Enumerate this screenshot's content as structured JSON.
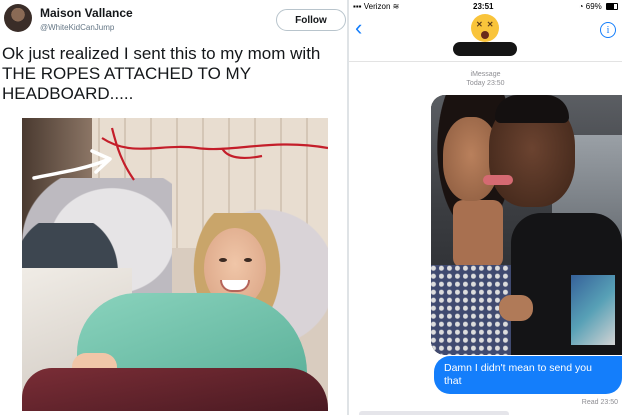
{
  "tweet": {
    "author_name": "Maison Vallance",
    "author_handle": "@WhiteKidCanJump",
    "follow_label": "Follow",
    "text": "Ok just realized I sent this to my mom with THE ROPES ATTACHED TO MY HEADBOARD.....",
    "photo_icons": [
      "white-arrow",
      "red-ropes"
    ]
  },
  "imessage": {
    "status_bar": {
      "carrier": "Verizon",
      "time": "23:51",
      "battery": "69%"
    },
    "header": {
      "back_icon": "chevron-left-icon",
      "contact_avatar_icon": "dizzy-face-emoji",
      "info_icon": "info-icon",
      "info_glyph": "i"
    },
    "thread_meta_line1": "iMessage",
    "thread_meta_line2": "Today 23:50",
    "sent_message": "Damn I didn't mean to send you that",
    "read_receipt": "Read 23:50",
    "colors": {
      "bubble_blue": "#147efb",
      "avatar_yellow": "#f9c43b"
    }
  }
}
